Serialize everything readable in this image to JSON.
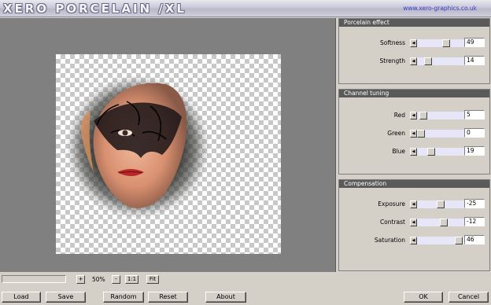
{
  "header": {
    "app_title": "XERO PORCELAIN /XL",
    "url": "www.xero-graphics.co.uk"
  },
  "panels": [
    {
      "title": "Porcelain effect",
      "rows": [
        {
          "label": "Softness",
          "value": "49",
          "fraction": 0.49
        },
        {
          "label": "Strength",
          "value": "14",
          "fraction": 0.14
        }
      ]
    },
    {
      "title": "Channel tuning",
      "rows": [
        {
          "label": "Red",
          "value": "5",
          "fraction": 0.05
        },
        {
          "label": "Green",
          "value": "0",
          "fraction": 0.0
        },
        {
          "label": "Blue",
          "value": "19",
          "fraction": 0.19
        }
      ]
    },
    {
      "title": "Compensation",
      "rows": [
        {
          "label": "Exposure",
          "value": "-25",
          "fraction": 0.375
        },
        {
          "label": "Contrast",
          "value": "-12",
          "fraction": 0.44
        },
        {
          "label": "Saturation",
          "value": "46",
          "fraction": 0.73
        }
      ]
    }
  ],
  "zoom": {
    "plus_label": "+",
    "minus_label": "-",
    "level": "50%",
    "one_to_one_label": "1:1",
    "fit_label": "Fit"
  },
  "buttons": {
    "load": "Load",
    "save": "Save",
    "random": "Random",
    "reset": "Reset",
    "about": "About",
    "ok": "OK",
    "cancel": "Cancel"
  }
}
